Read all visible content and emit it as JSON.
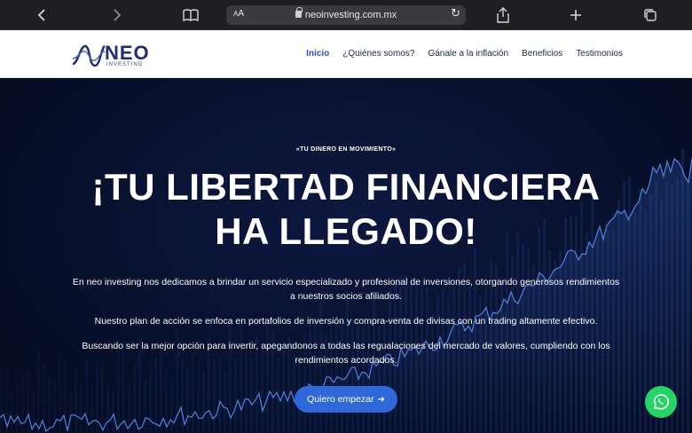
{
  "browser": {
    "back_icon": "chevron-left-icon",
    "forward_icon": "chevron-right-icon",
    "reader_icon": "book-icon",
    "text_size_label": "AA",
    "url": "neoinvesting.com.mx",
    "share_icon": "share-icon",
    "new_tab_icon": "plus-icon",
    "tabs_icon": "tabs-icon"
  },
  "nav": {
    "logo_word": "NEO",
    "logo_sub": "INVESTING",
    "items": [
      {
        "label": "Inicio",
        "active": true
      },
      {
        "label": "¿Quiénes somos?",
        "active": false
      },
      {
        "label": "Gánale a la inflación",
        "active": false
      },
      {
        "label": "Beneficios",
        "active": false
      },
      {
        "label": "Testimonios",
        "active": false
      }
    ]
  },
  "hero": {
    "tagline": "«TU DINERO EN MOVIMIENTO»",
    "title_line1": "¡TU LIBERTAD FINANCIERA",
    "title_line2": "HA LLEGADO!",
    "paragraph1": "En neo investing nos dedicamos a brindar un servicio especializado y profesional de inversiones, otorgando generosos rendimientos a nuestros socios afiliados.",
    "paragraph2": "Nuestro plan de acción se enfoca en portafolios de inversión y compra-venta de divisas con un trading altamente efectivo.",
    "paragraph3": "Buscando ser la mejor opción para invertir, apegandonos a todas las regualaciones del mercado de valores, cumpliendo con los rendimientos acordados.",
    "cta_label": "Quiero empezar",
    "cta_icon": "arrow-right-icon"
  },
  "whatsapp": {
    "icon": "whatsapp-icon",
    "color": "#25d366"
  },
  "colors": {
    "accent": "#2f55c4",
    "button": "#2f68d8",
    "hero_bg": "#07102b"
  }
}
